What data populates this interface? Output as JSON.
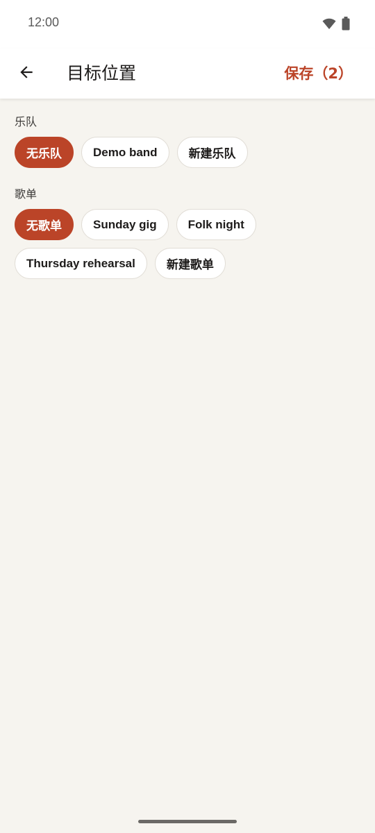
{
  "status_bar": {
    "time": "12:00",
    "wifi_icon": "wifi-icon",
    "battery_icon": "battery-icon"
  },
  "app_bar": {
    "back_icon": "arrow-back-icon",
    "title": "目标位置",
    "save_label": "保存（2）"
  },
  "band_section": {
    "label": "乐队",
    "chips": [
      {
        "label": "无乐队",
        "selected": true
      },
      {
        "label": "Demo band",
        "selected": false
      },
      {
        "label": "新建乐队",
        "selected": false
      }
    ]
  },
  "setlist_section": {
    "label": "歌单",
    "chips": [
      {
        "label": "无歌单",
        "selected": true
      },
      {
        "label": "Sunday gig",
        "selected": false
      },
      {
        "label": "Folk night",
        "selected": false
      },
      {
        "label": "Thursday rehearsal",
        "selected": false
      },
      {
        "label": "新建歌单",
        "selected": false
      }
    ]
  },
  "colors": {
    "accent": "#bb4428",
    "background": "#f6f4ef",
    "surface": "#ffffff"
  }
}
